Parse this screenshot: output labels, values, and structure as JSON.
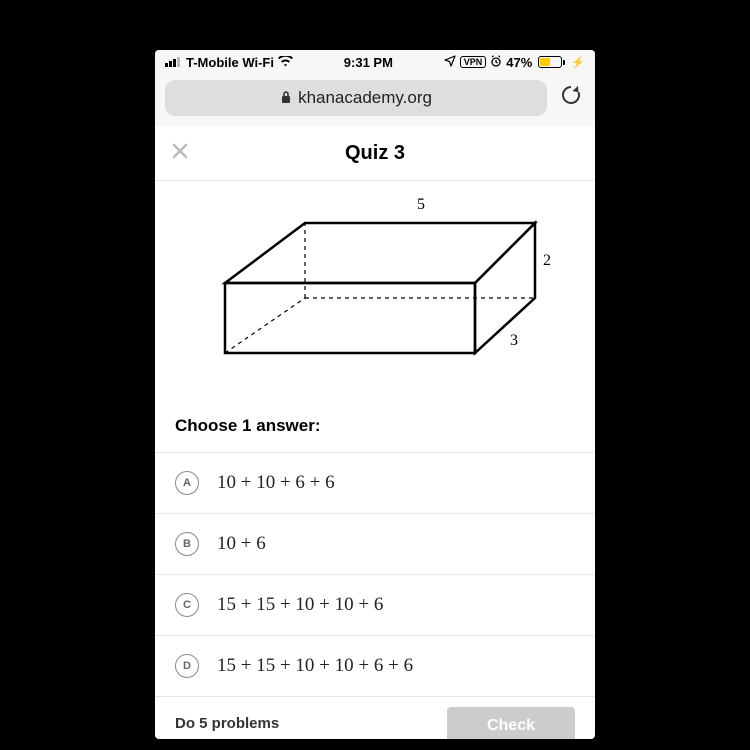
{
  "status": {
    "carrier": "T-Mobile Wi-Fi",
    "time": "9:31 PM",
    "vpn": "VPN",
    "battery_pct": "47%"
  },
  "browser": {
    "url": "khanacademy.org"
  },
  "quiz": {
    "title": "Quiz 3",
    "dimensions": {
      "width": "5",
      "height": "2",
      "depth": "3"
    },
    "prompt": "Choose 1 answer:",
    "answers": [
      {
        "letter": "A",
        "text": "10 + 10 + 6 + 6"
      },
      {
        "letter": "B",
        "text": "10 + 6"
      },
      {
        "letter": "C",
        "text": "15 + 15 + 10 + 10 + 6"
      },
      {
        "letter": "D",
        "text": "15 + 15 + 10 + 10 + 6 + 6"
      }
    ],
    "footer_text": "Do 5 problems",
    "check_label": "Check"
  }
}
